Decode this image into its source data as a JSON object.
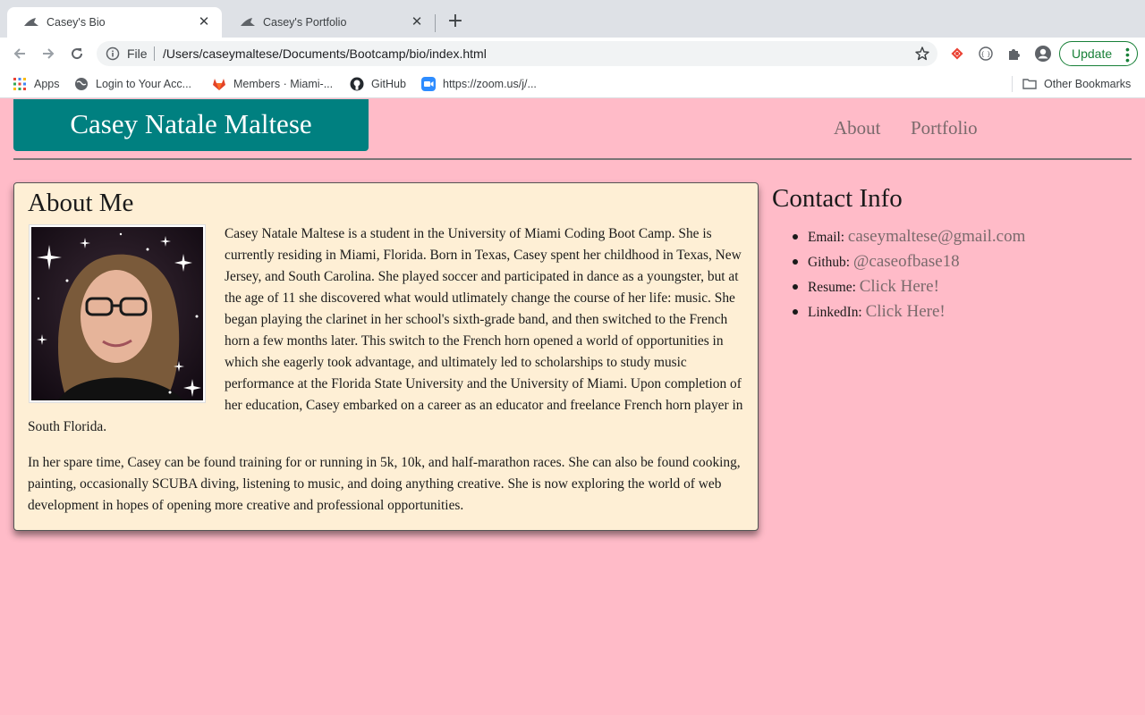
{
  "browser": {
    "tabs": [
      {
        "title": "Casey's Bio",
        "active": true
      },
      {
        "title": "Casey's Portfolio",
        "active": false
      }
    ],
    "address": {
      "scheme": "File",
      "url": "/Users/caseymaltese/Documents/Bootcamp/bio/index.html"
    },
    "update_label": "Update",
    "bookmarks": [
      {
        "label": "Apps",
        "icon": "apps-grid-icon"
      },
      {
        "label": "Login to Your Acc...",
        "icon": "globe-icon"
      },
      {
        "label": "Members · Miami-...",
        "icon": "gitlab-icon"
      },
      {
        "label": "GitHub",
        "icon": "github-icon"
      },
      {
        "label": "https://zoom.us/j/...",
        "icon": "zoom-icon"
      }
    ],
    "other_bookmarks": "Other Bookmarks",
    "colors": {
      "update_green": "#188038",
      "zoom_blue": "#2d8cff",
      "gitlab_orange": "#e24329"
    }
  },
  "site": {
    "brand": "Casey Natale Maltese",
    "nav": {
      "about": "About",
      "portfolio": "Portfolio"
    },
    "colors": {
      "background": "#ffbbc8",
      "brand_bg": "#008080",
      "card_bg": "#feefd5",
      "link": "#7a6a6c"
    }
  },
  "about": {
    "title": "About Me",
    "paragraphs": [
      "Casey Natale Maltese is a student in the University of Miami Coding Boot Camp. She is currently residing in Miami, Florida. Born in Texas, Casey spent her childhood in Texas, New Jersey, and South Carolina. She played soccer and participated in dance as a youngster, but at the age of 11 she discovered what would utlimately change the course of her life: music. She began playing the clarinet in her school's sixth-grade band, and then switched to the French horn a few months later. This switch to the French horn opened a world of opportunities in which she eagerly took advantage, and ultimately led to scholarships to study music performance at the Florida State University and the University of Miami. Upon completion of her education, Casey embarked on a career as an educator and freelance French horn player in South Florida.",
      "In her spare time, Casey can be found training for or running in 5k, 10k, and half-marathon races. She can also be found cooking, painting, occasionally SCUBA diving, listening to music, and doing anything creative. She is now exploring the world of web development in hopes of opening more creative and professional opportunities."
    ]
  },
  "contact": {
    "title": "Contact Info",
    "items": [
      {
        "label": "Email:",
        "link": "caseymaltese@gmail.com"
      },
      {
        "label": "Github:",
        "link": "@caseofbase18"
      },
      {
        "label": "Resume:",
        "link": "Click Here!"
      },
      {
        "label": "LinkedIn:",
        "link": "Click Here!"
      }
    ]
  }
}
